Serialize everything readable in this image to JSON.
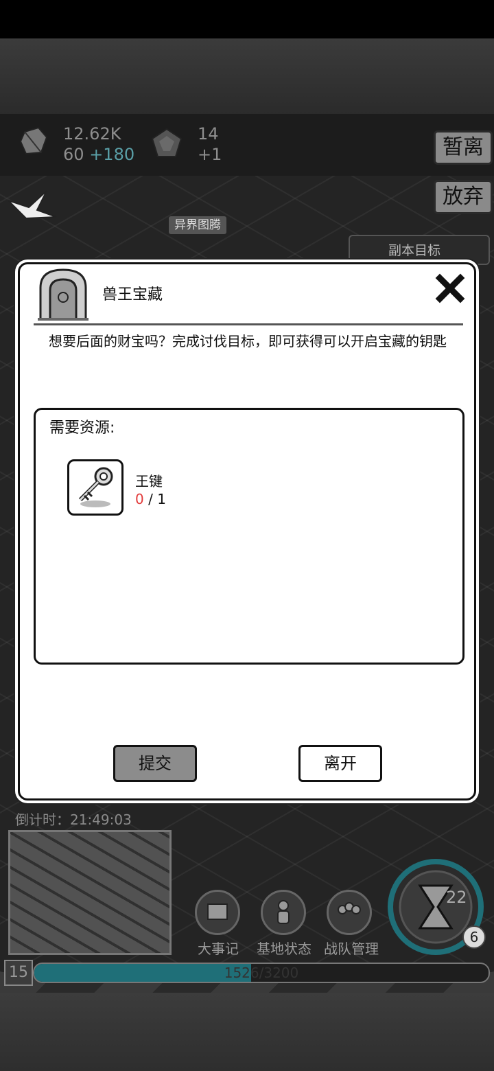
{
  "hud": {
    "crystals_total": "12.62K",
    "crystals_rate": "60",
    "crystals_bonus": "+180",
    "gems_total": "14",
    "gems_bonus": "+1",
    "pause_button": "暂离",
    "abandon_button": "放弃",
    "totem_label": "异界图腾",
    "goal_panel_label": "副本目标"
  },
  "modal": {
    "title": "兽王宝藏",
    "description": "想要后面的财宝吗？完成讨伐目标，即可获得可以开启宝藏的钥匙",
    "required_title": "需要资源:",
    "item": {
      "name": "王键",
      "have": "0",
      "sep": " / ",
      "need": "1"
    },
    "submit_button": "提交",
    "leave_button": "离开"
  },
  "bottom": {
    "countdown": "倒计时：21:49:03",
    "chronicle_label": "大事记",
    "base_status_label": "基地状态",
    "team_manage_label": "战队管理",
    "time_value": "22",
    "badge_value": "6",
    "level": "15",
    "exp_text": "1526/3200",
    "exp_progress": 0.477
  },
  "colors": {
    "accent_teal": "#1f6f78",
    "bonus_teal": "#5aa0a8",
    "missing_red": "#e23b3b"
  }
}
